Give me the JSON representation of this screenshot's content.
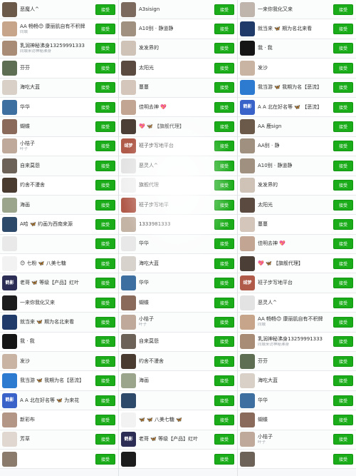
{
  "colors": {
    "accent": "#1aad19",
    "background": "#f7f8f9",
    "name_text": "#333333",
    "sub_text": "#9aa0a6"
  },
  "columns": [
    {
      "rows": [
        {
          "name": "恶魔人^",
          "sub": "",
          "btn": "接受",
          "avatar_color": "#6b5a4a"
        },
        {
          "name": "AA 畅畅😊 康丽肌自有不积牌",
          "sub": "同城",
          "btn": "接受",
          "avatar_color": "#c7a58a"
        },
        {
          "name": "乳润神秘沸身13259991333",
          "sub": "同城来访神秘沸身",
          "btn": "接受",
          "avatar_color": "#a98c76"
        },
        {
          "name": "芬芬",
          "sub": "",
          "btn": "接受",
          "avatar_color": "#5e6e52"
        },
        {
          "name": "海吃大蓝",
          "sub": "",
          "btn": "接受",
          "avatar_color": "#d9d1c8"
        },
        {
          "name": "华华",
          "sub": "",
          "btn": "接受",
          "avatar_color": "#3d6fa0"
        },
        {
          "name": "蝴蝶",
          "sub": "",
          "btn": "接受",
          "avatar_color": "#8a6a5a"
        },
        {
          "name": "小桔子",
          "sub": "叶子",
          "btn": "接受",
          "avatar_color": "#bfa99a"
        },
        {
          "name": "自来莫怨",
          "sub": "",
          "btn": "接受",
          "avatar_color": "#6c6258"
        },
        {
          "name": "约舍不漫舍",
          "sub": "",
          "btn": "接受",
          "avatar_color": "#4a3b30"
        },
        {
          "name": "海画",
          "sub": "",
          "btn": "接受",
          "avatar_color": "#9aa58c"
        },
        {
          "name": "A哈 🦋 约画为西南来源",
          "sub": "",
          "btn": "接受",
          "avatar_color": "#2e4a6b"
        },
        {
          "name": "",
          "sub": "",
          "btn": "接受",
          "avatar_color": "#e9e9e9"
        },
        {
          "name": "😊 七粉 🦋 八美七糖",
          "sub": "",
          "btn": "接受",
          "avatar_color": "#f2f2f2"
        },
        {
          "name": "老哥 🦋 等级【产品】红叶",
          "sub": "",
          "btn": "接受",
          "avatar_color": "#2b2d55",
          "avatar_text": "鹤影"
        },
        {
          "name": "一来你我化又来",
          "sub": "",
          "btn": "接受",
          "avatar_color": "#1c1c1c"
        },
        {
          "name": "就当来 🦋 期为名北来看",
          "sub": "",
          "btn": "接受",
          "avatar_color": "#203b6a"
        },
        {
          "name": "我 · 我",
          "sub": "",
          "btn": "接受",
          "avatar_color": "#151515"
        },
        {
          "name": "发沙",
          "sub": "",
          "btn": "接受",
          "avatar_color": "#c9b3a3"
        },
        {
          "name": "我当游 🦋 我期为名【恶流】",
          "sub": "",
          "btn": "接受",
          "avatar_color": "#2c7bd1"
        },
        {
          "name": "A A 北在好名等 🦋 为来花",
          "sub": "",
          "btn": "接受",
          "avatar_color": "#3a63c9",
          "avatar_text": "鹤影"
        },
        {
          "name": "新彩布",
          "sub": "",
          "btn": "接受",
          "avatar_color": "#b39685"
        },
        {
          "name": "芳草",
          "sub": "",
          "btn": "接受",
          "avatar_color": "#e0d8d0"
        },
        {
          "name": "",
          "sub": "",
          "btn": "接受",
          "avatar_color": "#8a7b6c"
        }
      ]
    },
    {
      "rows": [
        {
          "name": "A3sisign",
          "sub": "",
          "btn": "接受",
          "avatar_color": "#7b6a5d"
        },
        {
          "name": "A10别 · 静道静",
          "sub": "",
          "btn": "接受",
          "avatar_color": "#a09080"
        },
        {
          "name": "发发界的",
          "sub": "",
          "btn": "接受",
          "avatar_color": "#cfc2b7"
        },
        {
          "name": "太阳光",
          "sub": "",
          "btn": "接受",
          "avatar_color": "#5a4a40"
        },
        {
          "name": "蔓蔓",
          "sub": "",
          "btn": "接受",
          "avatar_color": "#d4c6ba"
        },
        {
          "name": "佳明去神 💖",
          "sub": "",
          "btn": "接受",
          "avatar_color": "#c2a592"
        },
        {
          "name": "💖 🦋 【旗舰代理】",
          "sub": "",
          "btn": "接受",
          "avatar_color": "#4b3e36"
        },
        {
          "name": "班子步写地平台",
          "sub": "",
          "btn": "接受",
          "avatar_color": "#b05a4a",
          "avatar_text": "绒梦"
        },
        {
          "name": "恶灵人^",
          "sub": "",
          "btn": "接受",
          "avatar_color": "#e3e3e3"
        },
        {
          "name": "旗舰代理",
          "sub": "",
          "btn": "接受",
          "avatar_color": "#f0f0f0"
        },
        {
          "name": "班子步写地平",
          "sub": "",
          "btn": "接受",
          "avatar_color": "#b05a4a"
        },
        {
          "name": "1333981333",
          "sub": "",
          "btn": "接受",
          "avatar_color": "#c4b4a6"
        },
        {
          "name": "华华",
          "sub": "",
          "btn": "接受",
          "avatar_color": "#e8e8e8"
        },
        {
          "name": "海吃大蓝",
          "sub": "",
          "btn": "接受",
          "avatar_color": "#d8d2cc"
        },
        {
          "name": "华华",
          "sub": "",
          "btn": "接受",
          "avatar_color": "#3d6fa0"
        },
        {
          "name": "蝴蝶",
          "sub": "",
          "btn": "接受",
          "avatar_color": "#8a6a5a"
        },
        {
          "name": "小桔子",
          "sub": "叶子",
          "btn": "接受",
          "avatar_color": "#bfa99a"
        },
        {
          "name": "自来莫怨",
          "sub": "",
          "btn": "接受",
          "avatar_color": "#6c6258"
        },
        {
          "name": "约舍不漫舍",
          "sub": "",
          "btn": "接受",
          "avatar_color": "#4a3b30"
        },
        {
          "name": "海画",
          "sub": "",
          "btn": "接受",
          "avatar_color": "#9aa58c"
        },
        {
          "name": "",
          "sub": "",
          "btn": "接受",
          "avatar_color": "#2e4a6b"
        },
        {
          "name": "🦋 🦋 八美七糖 🦋",
          "sub": "",
          "btn": "接受",
          "avatar_color": "#f2f2f2"
        },
        {
          "name": "老哥 🦋 等级【产品】红叶",
          "sub": "",
          "btn": "接受",
          "avatar_color": "#2b2d55",
          "avatar_text": "鹤影"
        },
        {
          "name": "",
          "sub": "",
          "btn": "接受",
          "avatar_color": "#1c1c1c"
        }
      ]
    },
    {
      "rows": [
        {
          "name": "一来你我化又来",
          "sub": "",
          "btn": "接受",
          "avatar_color": "#bfb5ad"
        },
        {
          "name": "就当来 🦋 期为名北来看",
          "sub": "",
          "btn": "接受",
          "avatar_color": "#203b6a"
        },
        {
          "name": "我 · 我",
          "sub": "",
          "btn": "接受",
          "avatar_color": "#151515"
        },
        {
          "name": "发沙",
          "sub": "",
          "btn": "接受",
          "avatar_color": "#c9b3a3"
        },
        {
          "name": "我当游 🦋 我期为名【恶流】",
          "sub": "",
          "btn": "接受",
          "avatar_color": "#2c7bd1"
        },
        {
          "name": "A A 北在好名等 🦋 【恶流】",
          "sub": "",
          "btn": "接受",
          "avatar_color": "#3a63c9",
          "avatar_text": "鹤影"
        },
        {
          "name": "AA 鹿sign",
          "sub": "",
          "btn": "接受",
          "avatar_color": "#6b5a4a"
        },
        {
          "name": "AA别 · 静",
          "sub": "",
          "btn": "接受",
          "avatar_color": "#a09080"
        },
        {
          "name": "A10别 · 静道静",
          "sub": "",
          "btn": "接受",
          "avatar_color": "#a09080"
        },
        {
          "name": "发发界的",
          "sub": "",
          "btn": "接受",
          "avatar_color": "#cfc2b7"
        },
        {
          "name": "太阳光",
          "sub": "",
          "btn": "接受",
          "avatar_color": "#5a4a40"
        },
        {
          "name": "蔓蔓",
          "sub": "",
          "btn": "接受",
          "avatar_color": "#d4c6ba"
        },
        {
          "name": "佳明去神 💖",
          "sub": "",
          "btn": "接受",
          "avatar_color": "#c2a592"
        },
        {
          "name": "💖 🦋 【旗舰代理】",
          "sub": "",
          "btn": "接受",
          "avatar_color": "#4b3e36"
        },
        {
          "name": "班子步写地平台",
          "sub": "",
          "btn": "接受",
          "avatar_color": "#b05a4a",
          "avatar_text": "绒梦"
        },
        {
          "name": "恶灵人^",
          "sub": "",
          "btn": "接受",
          "avatar_color": "#e3e3e3"
        },
        {
          "name": "AA 畅畅😊 康丽肌自有不积牌",
          "sub": "同城",
          "btn": "接受",
          "avatar_color": "#c7a58a"
        },
        {
          "name": "乳润神秘沸身13259991333",
          "sub": "同城来访神秘沸身",
          "btn": "接受",
          "avatar_color": "#a98c76"
        },
        {
          "name": "芬芬",
          "sub": "",
          "btn": "接受",
          "avatar_color": "#5e6e52"
        },
        {
          "name": "海吃大蓝",
          "sub": "",
          "btn": "接受",
          "avatar_color": "#d9d1c8"
        },
        {
          "name": "华华",
          "sub": "",
          "btn": "接受",
          "avatar_color": "#3d6fa0"
        },
        {
          "name": "蝴蝶",
          "sub": "",
          "btn": "接受",
          "avatar_color": "#8a6a5a"
        },
        {
          "name": "小桔子",
          "sub": "叶子",
          "btn": "接受",
          "avatar_color": "#bfa99a"
        },
        {
          "name": "",
          "sub": "",
          "btn": "接受",
          "avatar_color": "#6c6258"
        }
      ]
    }
  ]
}
